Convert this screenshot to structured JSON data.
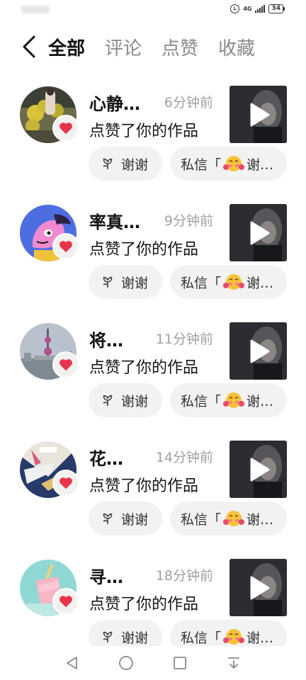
{
  "header": {
    "tabs": [
      {
        "label": "全部",
        "active": true
      },
      {
        "label": "评论",
        "active": false
      },
      {
        "label": "点赞",
        "active": false
      },
      {
        "label": "收藏",
        "active": false
      }
    ]
  },
  "status_bar": {
    "network": "4G",
    "battery": "34"
  },
  "items": [
    {
      "name": "心静…",
      "time": "6分钟前",
      "action": "点赞了你的作品",
      "thanks_label": "谢谢",
      "msg_prefix": "私信「",
      "msg_suffix": "谢…"
    },
    {
      "name": "率真…",
      "time": "9分钟前",
      "action": "点赞了你的作品",
      "thanks_label": "谢谢",
      "msg_prefix": "私信「",
      "msg_suffix": "谢…"
    },
    {
      "name": "将…",
      "time": "11分钟前",
      "action": "点赞了你的作品",
      "thanks_label": "谢谢",
      "msg_prefix": "私信「",
      "msg_suffix": "谢…"
    },
    {
      "name": "花…",
      "time": "14分钟前",
      "action": "点赞了你的作品",
      "thanks_label": "谢谢",
      "msg_prefix": "私信「",
      "msg_suffix": "谢…"
    },
    {
      "name": "寻…",
      "time": "18分钟前",
      "action": "点赞了你的作品",
      "thanks_label": "谢谢",
      "msg_prefix": "私信「",
      "msg_suffix": "谢…"
    }
  ],
  "icons": {
    "back": "chevron-left-icon",
    "heart": "heart-icon",
    "play": "play-icon",
    "thanks": "flower-icon",
    "emoji": "blush-emoji-icon",
    "nav": [
      "back-triangle-icon",
      "home-circle-icon",
      "recents-square-icon",
      "notification-pull-icon"
    ]
  },
  "colors": {
    "heart": "#e8344a",
    "time_text": "#a0a0a0",
    "button_bg": "#f2f2f2",
    "inactive_tab": "#8a8a8a"
  }
}
